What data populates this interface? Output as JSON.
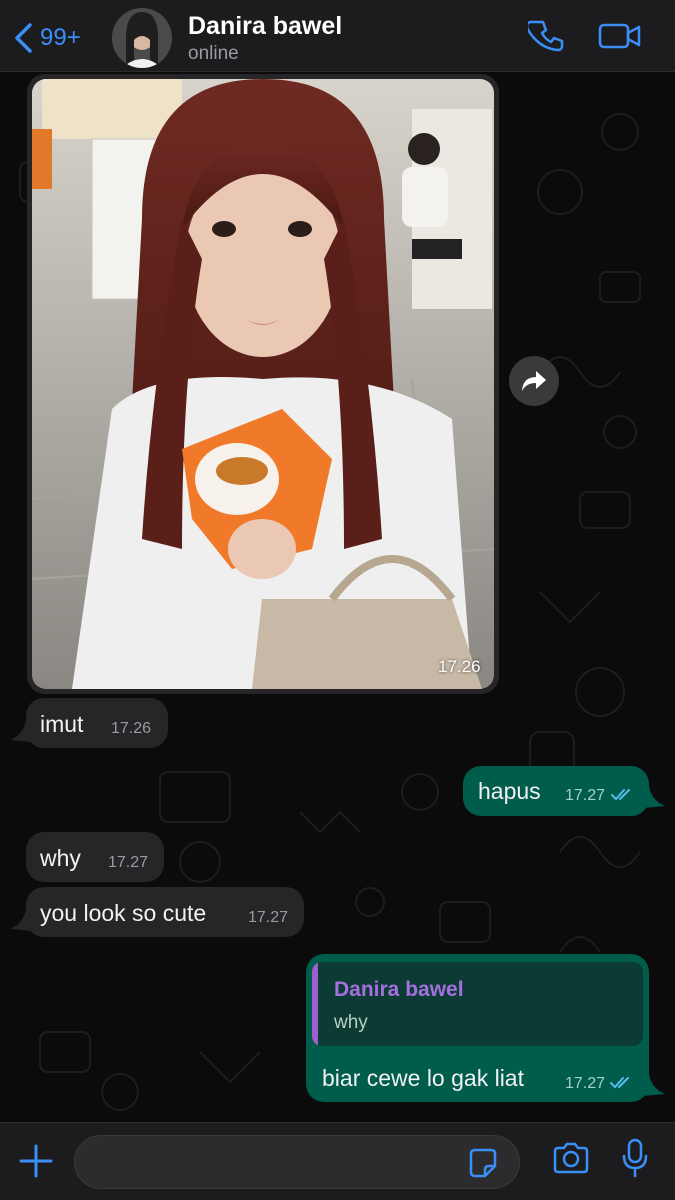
{
  "header": {
    "back_count": "99+",
    "contact_name": "Danira bawel",
    "status": "online"
  },
  "messages": [
    {
      "type": "image",
      "direction": "incoming",
      "time": "17.26"
    },
    {
      "type": "text",
      "direction": "incoming",
      "text": "imut",
      "time": "17.26"
    },
    {
      "type": "text",
      "direction": "outgoing",
      "text": "hapus",
      "time": "17.27",
      "read": true
    },
    {
      "type": "text",
      "direction": "incoming",
      "text": "why",
      "time": "17.27"
    },
    {
      "type": "text",
      "direction": "incoming",
      "text": "you look so cute",
      "time": "17.27"
    },
    {
      "type": "reply",
      "direction": "outgoing",
      "quoted_name": "Danira bawel",
      "quoted_text": "why",
      "text": "biar cewe lo gak liat",
      "time": "17.27",
      "read": true
    }
  ],
  "composer": {
    "value": "",
    "placeholder": ""
  },
  "colors": {
    "accent": "#3a8ff7",
    "incoming_bubble": "#262628",
    "outgoing_bubble": "#005c4b",
    "read_ticks": "#53bdeb",
    "quote_name": "#a66fe0"
  },
  "icons": [
    "chevron-left-icon",
    "phone-icon",
    "video-call-icon",
    "forward-icon",
    "plus-icon",
    "sticker-icon",
    "camera-icon",
    "microphone-icon",
    "double-check-icon"
  ]
}
